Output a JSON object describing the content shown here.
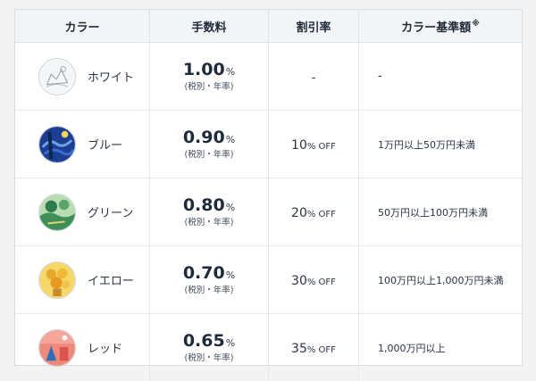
{
  "headers": {
    "color": "カラー",
    "fee": "手数料",
    "discount": "割引率",
    "basis": "カラー基準額",
    "basis_note": "※"
  },
  "rows": [
    {
      "color_name": "ホワイト",
      "swatch": "white",
      "swatch_color": "#e9ecef",
      "fee_value": "1.00",
      "fee_unit": "%",
      "fee_note": "(税別・年率)",
      "discount": "-",
      "discount_suffix": "",
      "basis": "-"
    },
    {
      "color_name": "ブルー",
      "swatch": "blue",
      "swatch_color": "#1f4fa8",
      "fee_value": "0.90",
      "fee_unit": "%",
      "fee_note": "(税別・年率)",
      "discount": "10",
      "discount_suffix": "% OFF",
      "basis": "1万円以上50万円未満"
    },
    {
      "color_name": "グリーン",
      "swatch": "green",
      "swatch_color": "#3f8f5a",
      "fee_value": "0.80",
      "fee_unit": "%",
      "fee_note": "(税別・年率)",
      "discount": "20",
      "discount_suffix": "% OFF",
      "basis": "50万円以上100万円未満"
    },
    {
      "color_name": "イエロー",
      "swatch": "yellow",
      "swatch_color": "#f2c23a",
      "fee_value": "0.70",
      "fee_unit": "%",
      "fee_note": "(税別・年率)",
      "discount": "30",
      "discount_suffix": "% OFF",
      "basis": "100万円以上1,000万円未満"
    },
    {
      "color_name": "レッド",
      "swatch": "red",
      "swatch_color": "#e97b6d",
      "fee_value": "0.65",
      "fee_unit": "%",
      "fee_note": "(税別・年率)",
      "discount": "35",
      "discount_suffix": "% OFF",
      "basis": "1,000万円以上"
    }
  ]
}
